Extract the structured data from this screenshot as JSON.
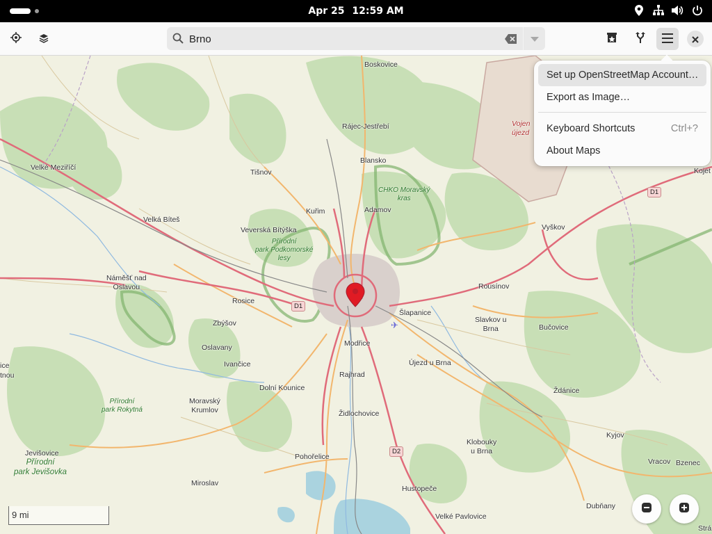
{
  "topbar": {
    "date": "Apr 25",
    "time": "12:59 AM",
    "icons": [
      "location-icon",
      "network-icon",
      "volume-icon",
      "power-icon"
    ]
  },
  "header": {
    "locate_icon": "locate-icon",
    "layers_icon": "layers-icon",
    "search": {
      "value": "Brno",
      "placeholder": ""
    },
    "right_icons": [
      "favorites-icon",
      "route-icon",
      "hamburger-menu-icon",
      "close-icon"
    ]
  },
  "menu": {
    "items": [
      {
        "label": "Set up OpenStreetMap Account…",
        "shortcut": ""
      },
      {
        "label": "Export as Image…",
        "shortcut": ""
      },
      {
        "label": "Keyboard Shortcuts",
        "shortcut": "Ctrl+?"
      },
      {
        "label": "About Maps",
        "shortcut": ""
      }
    ]
  },
  "map": {
    "places": {
      "boskovice": "Boskovice",
      "rajec": "Rájec-Jestřebí",
      "blansko": "Blansko",
      "tisnov": "Tišnov",
      "velke_mezirici": "Velké Meziříčí",
      "velka_bites": "Velká Bíteš",
      "kurim": "Kuřim",
      "adamov": "Adamov",
      "veverska": "Veverská Bítýška",
      "vyskov": "Vyškov",
      "namest": "Náměšť nad\nOslavou",
      "rosice": "Rosice",
      "zbysov": "Zbýšov",
      "oslavany": "Oslavany",
      "ivancice": "Ivančice",
      "slapanice": "Šlapanice",
      "rousinov": "Rousínov",
      "slavkov": "Slavkov u\nBrna",
      "bucovice": "Bučovice",
      "modrice": "Modřice",
      "ujezd": "Újezd u Brna",
      "rajhrad": "Rajhrad",
      "dolni_kounice": "Dolní Kounice",
      "moravsky_krumlov": "Moravský\nKrumlov",
      "zidlochovice": "Židlochovice",
      "zdanice": "Ždánice",
      "kyjov": "Kyjov",
      "klobouky": "Klobouky\nu Brna",
      "jevisovice": "Jevišovice",
      "pohorelice": "Pohořelice",
      "miroslav": "Miroslav",
      "hustopece": "Hustopeče",
      "velke_pavlovice": "Velké Pavlovice",
      "dubnany": "Dubňany",
      "vracov": "Vracov",
      "bzenec": "Bzenec",
      "kojet": "Kojet",
      "ice": "ice",
      "tnou": "tnou",
      "straz": "Strá",
      "vojen": "Vojen\nújezd"
    },
    "parks": {
      "chko": "CHKO Moravský\nkras",
      "podkomorske": "Přírodní\npark Podkomorské\nlesy",
      "rokytna": "Přírodní\npark Rokytná",
      "jevisovka": "Přírodní\npark Jevišovka"
    },
    "roads": {
      "d1_a": "D1",
      "d1_b": "D1",
      "d2": "D2"
    },
    "scale": "9 mi",
    "zoom_out_icon": "zoom-out-icon",
    "zoom_in_icon": "zoom-in-icon",
    "marker_icon": "location-marker-icon"
  }
}
